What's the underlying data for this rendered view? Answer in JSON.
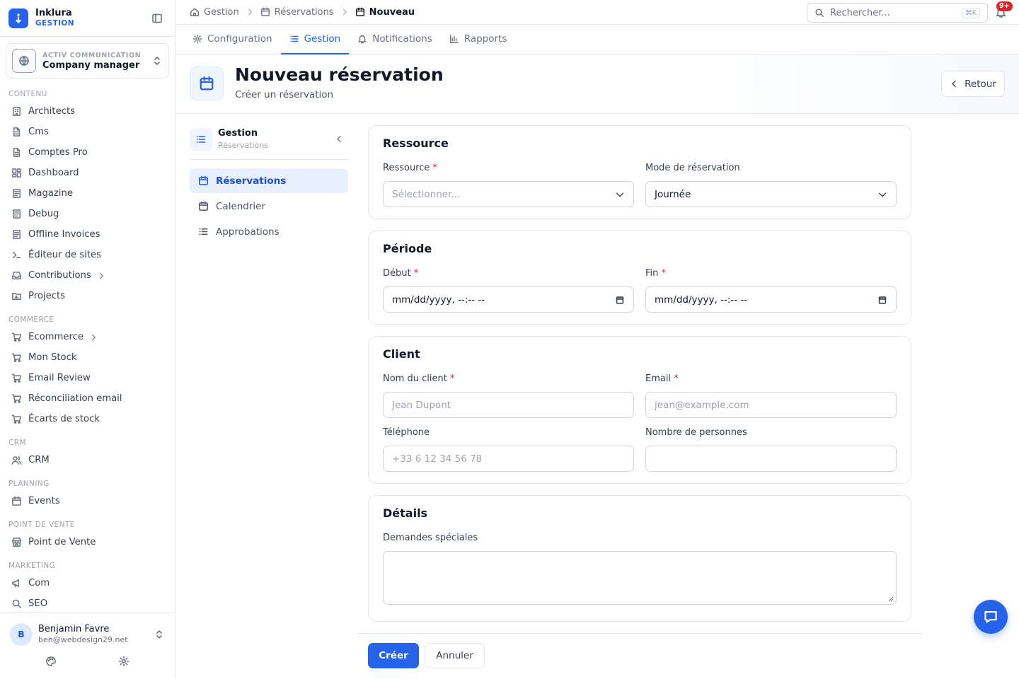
{
  "brand": {
    "name": "Inklura",
    "subtitle": "GESTION"
  },
  "org": {
    "kicker": "ACTIV COMMUNICATION",
    "name": "Company manager"
  },
  "nav": {
    "sections": {
      "contenu": "CONTENU",
      "commerce": "COMMERCE",
      "crm": "CRM",
      "planning": "PLANNING",
      "pos": "POINT DE VENTE",
      "marketing": "MARKETING"
    },
    "items": {
      "architects": "Architects",
      "cms": "Cms",
      "comptes_pro": "Comptes Pro",
      "dashboard": "Dashboard",
      "magazine": "Magazine",
      "debug": "Debug",
      "offline_invoices": "Offline Invoices",
      "editeur_sites": "Éditeur de sites",
      "contributions": "Contributions",
      "projects": "Projects",
      "ecommerce": "Ecommerce",
      "mon_stock": "Mon Stock",
      "email_review": "Email Review",
      "reconciliation": "Réconciliation email",
      "ecarts": "Écarts de stock",
      "crm": "CRM",
      "events": "Events",
      "point_de_vente": "Point de Vente",
      "com": "Com",
      "seo": "SEO"
    }
  },
  "user": {
    "initial": "B",
    "name": "Benjamin Favre",
    "email": "ben@webdesign29.net"
  },
  "breadcrumb": {
    "home": "Gestion",
    "section": "Réservations",
    "current": "Nouveau"
  },
  "search": {
    "placeholder": "Rechercher...",
    "shortcut": "⌘K"
  },
  "notifications": {
    "badge": "9+"
  },
  "tabs": {
    "configuration": "Configuration",
    "gestion": "Gestion",
    "notifications": "Notifications",
    "rapports": "Rapports"
  },
  "page": {
    "title": "Nouveau réservation",
    "subtitle": "Créer un réservation",
    "back": "Retour"
  },
  "subnav": {
    "title": "Gestion",
    "subtitle": "Réservations",
    "items": {
      "reservations": "Réservations",
      "calendrier": "Calendrier",
      "approbations": "Approbations"
    }
  },
  "form": {
    "ressource": {
      "title": "Ressource",
      "ressource_label": "Ressource",
      "ressource_placeholder": "Sélectionner...",
      "mode_label": "Mode de réservation",
      "mode_value": "Journée"
    },
    "periode": {
      "title": "Période",
      "debut_label": "Début",
      "debut_value": "mm/dd/yyyy, --:-- --",
      "fin_label": "Fin",
      "fin_value": "mm/dd/yyyy, --:-- --"
    },
    "client": {
      "title": "Client",
      "nom_label": "Nom du client",
      "nom_placeholder": "Jean Dupont",
      "email_label": "Email",
      "email_placeholder": "jean@example.com",
      "tel_label": "Téléphone",
      "tel_placeholder": "+33 6 12 34 56 78",
      "personnes_label": "Nombre de personnes",
      "personnes_value": ""
    },
    "details": {
      "title": "Détails",
      "demandes_label": "Demandes spéciales"
    },
    "required_mark": "*"
  },
  "actions": {
    "create": "Créer",
    "cancel": "Annuler"
  }
}
